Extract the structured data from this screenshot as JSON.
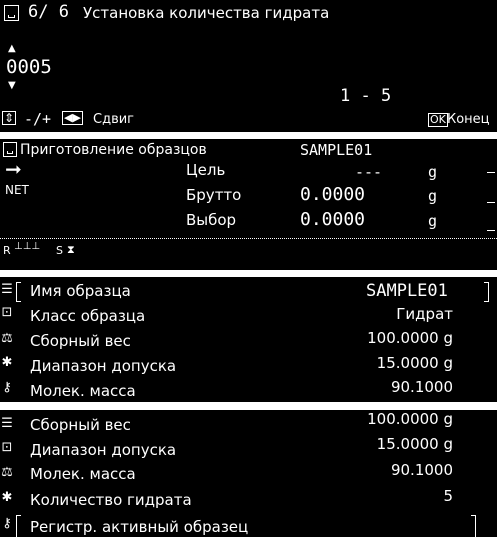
{
  "panel1": {
    "page": "6/ 6",
    "title": "Установка количества гидрата",
    "value": "0005",
    "range": "1 - 5",
    "footer_left_keys": "-/+",
    "footer_shift": "Сдвиг",
    "footer_ok": "OK",
    "footer_end": "Конец"
  },
  "panel2": {
    "title": "Приготовление образцов",
    "sample": "SAMPLE01",
    "net": "NET",
    "rows": [
      {
        "label": "Цель",
        "value": "---",
        "unit": "g"
      },
      {
        "label": "Брутто",
        "value": "0.0000",
        "unit": "g"
      },
      {
        "label": "Выбор",
        "value": "0.0000",
        "unit": "g"
      }
    ],
    "status_r": "R",
    "status_s": "S"
  },
  "panel3": {
    "rows": [
      {
        "label": "Имя образца",
        "value": "SAMPLE01"
      },
      {
        "label": "Класс образца",
        "value": "Гидрат"
      },
      {
        "label": "Сборный вес",
        "value": "100.0000 g"
      },
      {
        "label": "Диапазон допуска",
        "value": "15.0000 g"
      },
      {
        "label": "Молек. масса",
        "value": "90.1000"
      }
    ]
  },
  "panel4": {
    "rows": [
      {
        "label": "Сборный вес",
        "value": "100.0000 g"
      },
      {
        "label": "Диапазон допуска",
        "value": "15.0000 g"
      },
      {
        "label": "Молек. масса",
        "value": "90.1000"
      },
      {
        "label": "Количество гидрата",
        "value": "5"
      },
      {
        "label": "Регистр. активный образец",
        "value": ""
      }
    ]
  },
  "icons": [
    "list-icon",
    "doc-icon",
    "scale-icon",
    "gear-icon",
    "key-icon"
  ]
}
